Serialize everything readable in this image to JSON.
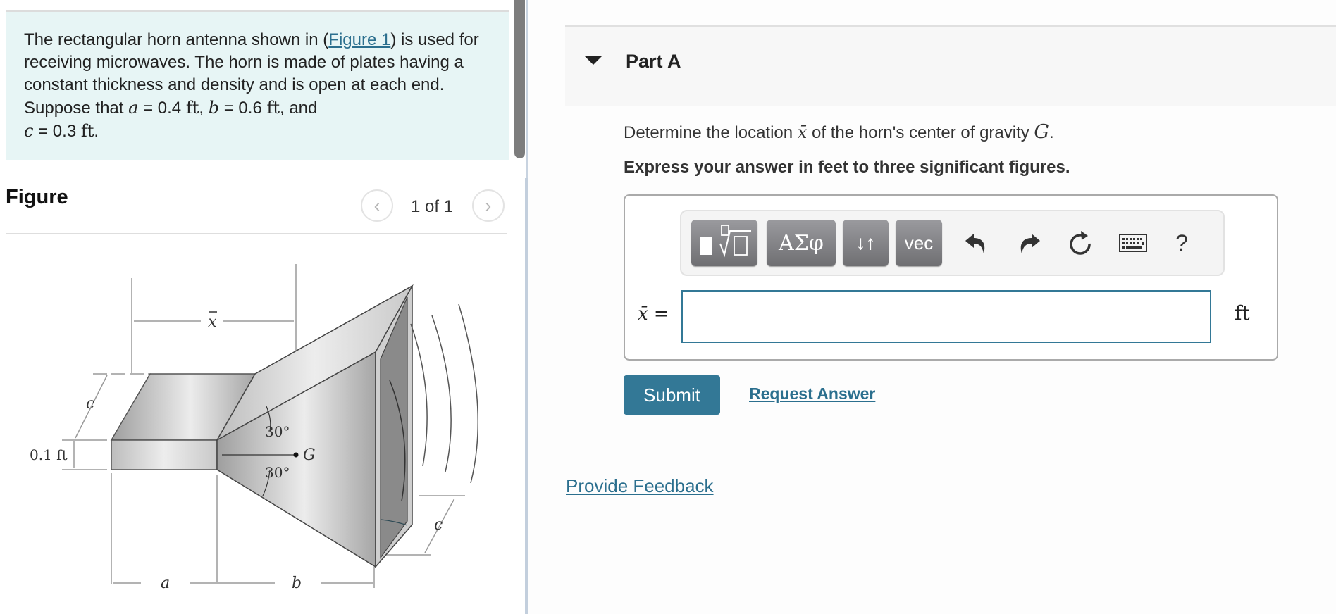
{
  "problem": {
    "text_before_link": "The rectangular horn antenna shown in (",
    "figure_link": "Figure 1",
    "text_after_link": ") is used for receiving microwaves. The horn is made of plates having a constant thickness and density and is open at each end. Suppose that ",
    "a_var": "a",
    "a_val": " = 0.4 ",
    "unit1": "ft",
    "sep1": ", ",
    "b_var": "b",
    "b_val": " = 0.6 ",
    "unit2": "ft",
    "sep2": ", and ",
    "c_var": "c",
    "c_val": " = 0.3 ",
    "unit3": "ft",
    "end": "."
  },
  "figure": {
    "title": "Figure",
    "counter": "1 of 1",
    "prev_icon": "chevron-left-icon",
    "next_icon": "chevron-right-icon",
    "labels": {
      "xbar": "x",
      "c_top": "c",
      "thickness": "0.1 ft",
      "angle_top": "30°",
      "angle_bottom": "30°",
      "G": "G",
      "c_bottom": "c",
      "a": "a",
      "b": "b"
    }
  },
  "part": {
    "title": "Part A",
    "question_pre": "Determine the location ",
    "question_var": "x̄",
    "question_mid": " of the horn's center of gravity ",
    "question_G": "G",
    "question_end": ".",
    "instruction": "Express your answer in feet to three significant figures."
  },
  "toolbar": {
    "buttons": [
      {
        "name": "templates-button",
        "icon": "fraction-root-icon"
      },
      {
        "name": "greek-symbols-button",
        "label": "ΑΣφ"
      },
      {
        "name": "arrows-button",
        "label": "↓↑"
      },
      {
        "name": "vector-button",
        "label": "vec"
      }
    ],
    "icons": [
      "undo-icon",
      "redo-icon",
      "reset-icon",
      "keyboard-icon",
      "help-icon"
    ],
    "help_label": "?"
  },
  "answer": {
    "label": "x̄ =",
    "value": "",
    "placeholder": "",
    "unit": "ft"
  },
  "actions": {
    "submit": "Submit",
    "request_answer": "Request Answer",
    "provide_feedback": "Provide Feedback"
  },
  "colors": {
    "accent": "#337896",
    "link": "#2b6f8e",
    "problem_bg": "#e7f5f5"
  }
}
